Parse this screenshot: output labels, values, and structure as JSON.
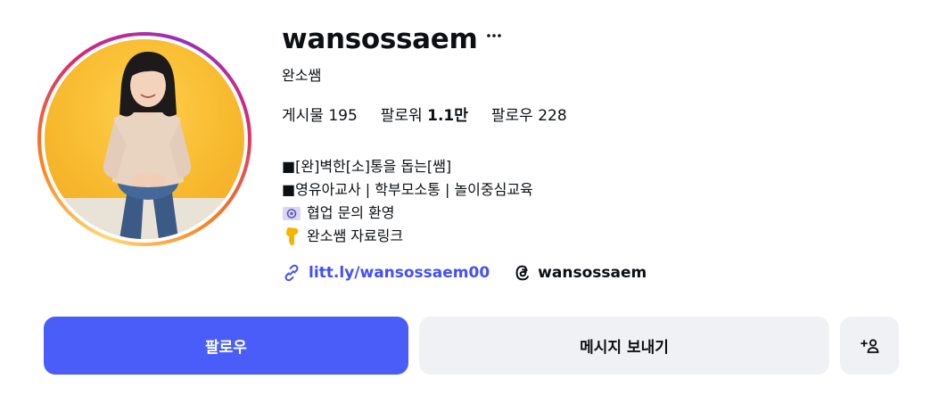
{
  "profile": {
    "username": "wansossaem",
    "full_name": "완소쌤",
    "more_icon": "more-horizontal-icon",
    "avatar_icon": "profile-photo",
    "ring_colors": [
      "#feda75",
      "#fa7e1e",
      "#d62976",
      "#962fbf"
    ]
  },
  "stats": {
    "posts_label": "게시물",
    "posts_value": "195",
    "followers_label": "팔로워",
    "followers_value": "1.1만",
    "following_label": "팔로우",
    "following_value": "228"
  },
  "bio": {
    "line1": "■[완]벽한[소]통을 돕는[쌤]",
    "line2": "■영유아교사 | 학부모소통 | 놀이중심교육",
    "line3": "협업 문의 환영",
    "line3_icon": "email-envelope-emoji-icon",
    "line4": "완소쌤 자료링크",
    "line4_icon": "pointing-down-hand-emoji-icon"
  },
  "links": {
    "external_url": "litt.ly/wansossaem00",
    "external_icon": "link-icon",
    "threads_handle": "wansossaem",
    "threads_icon": "threads-icon",
    "link_color": "#4150f7"
  },
  "actions": {
    "follow_label": "팔로우",
    "message_label": "메시지 보내기",
    "add_icon": "add-person-icon",
    "follow_color": "#4a5df9",
    "secondary_color": "#eff1f4"
  }
}
